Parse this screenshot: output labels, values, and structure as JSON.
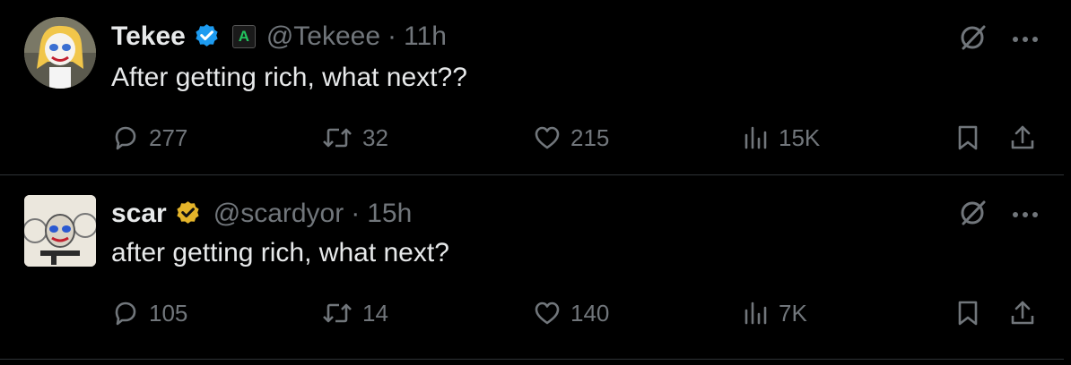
{
  "tweets": [
    {
      "name": "Tekee",
      "badge_color": "#1d9bf0",
      "affiliate_label": "A",
      "handle": "@Tekeee",
      "separator": "·",
      "time": "11h",
      "text": "After getting rich, what next??",
      "counts": {
        "replies": "277",
        "retweets": "32",
        "likes": "215",
        "views": "15K"
      }
    },
    {
      "name": "scar",
      "badge_color": "#e4b42a",
      "handle": "@scardyor",
      "separator": "·",
      "time": "15h",
      "text": "after getting rich, what next?",
      "counts": {
        "replies": "105",
        "retweets": "14",
        "likes": "140",
        "views": "7K"
      }
    }
  ],
  "icons": [
    "grok-icon",
    "more-icon",
    "reply-icon",
    "retweet-icon",
    "like-icon",
    "views-icon",
    "bookmark-icon",
    "share-icon"
  ],
  "colors": {
    "background": "#000000",
    "text": "#e7e9ea",
    "muted": "#71767b",
    "divider": "#2f3336"
  }
}
